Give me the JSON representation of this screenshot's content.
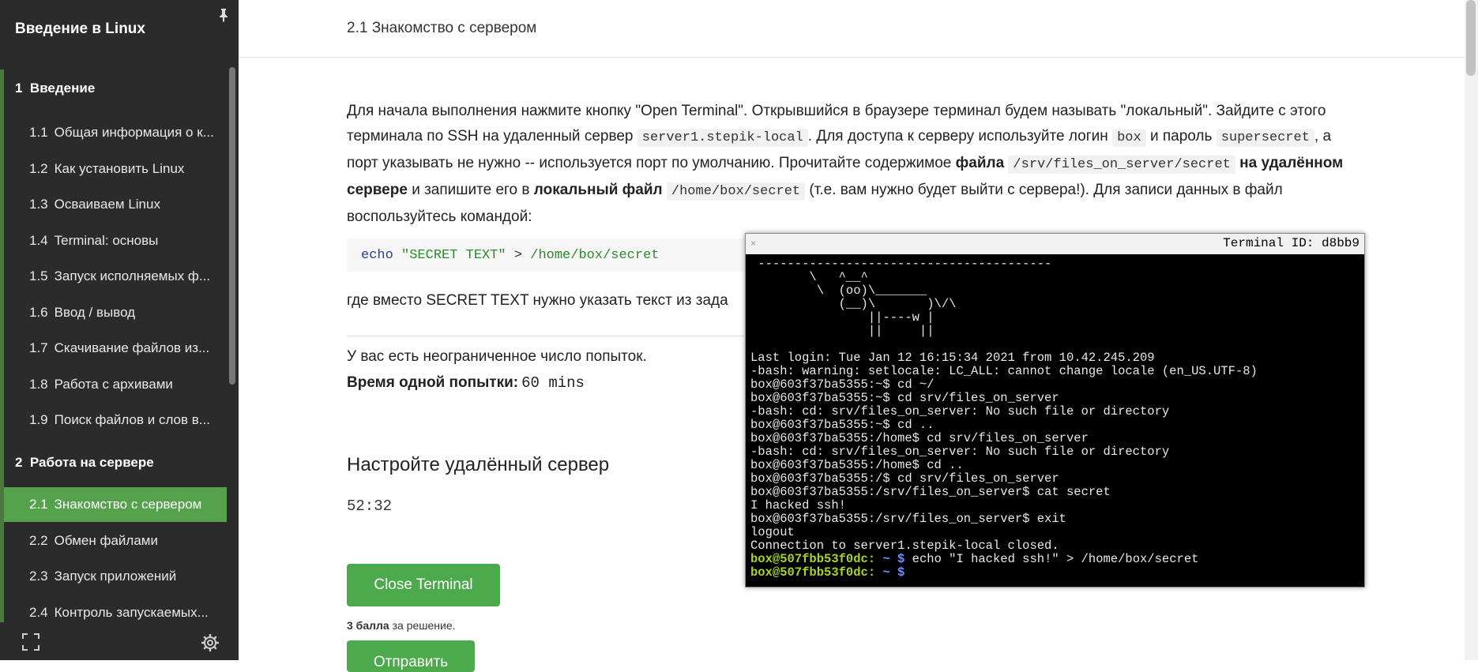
{
  "sidebar": {
    "title": "Введение в Linux",
    "modules": [
      {
        "number": "1",
        "title": "Введение"
      },
      {
        "number": "2",
        "title": "Работа на сервере"
      }
    ],
    "items": [
      {
        "number": "1.1",
        "label": "Общая информация о к..."
      },
      {
        "number": "1.2",
        "label": "Как установить Linux"
      },
      {
        "number": "1.3",
        "label": "Осваиваем Linux"
      },
      {
        "number": "1.4",
        "label": "Terminal: основы"
      },
      {
        "number": "1.5",
        "label": "Запуск исполняемых ф..."
      },
      {
        "number": "1.6",
        "label": "Ввод / вывод"
      },
      {
        "number": "1.7",
        "label": "Скачивание файлов из..."
      },
      {
        "number": "1.8",
        "label": "Работа с архивами"
      },
      {
        "number": "1.9",
        "label": "Поиск файлов и слов в..."
      },
      {
        "number": "2.1",
        "label": "Знакомство с сервером"
      },
      {
        "number": "2.2",
        "label": "Обмен файлами"
      },
      {
        "number": "2.3",
        "label": "Запуск приложений"
      },
      {
        "number": "2.4",
        "label": "Контроль запускаемых..."
      }
    ],
    "active_item": "2.1",
    "icons": {
      "pin": "pin-icon",
      "fullscreen": "fullscreen-icon",
      "settings": "gear-icon"
    }
  },
  "step": {
    "title": "2.1 Знакомство с сервером",
    "para": {
      "t1": "Для начала выполнения нажмите кнопку \"Open Terminal\". Открывшийся в браузере терминал будем называть \"локальный\". Зайдите с этого терминала по SSH на удаленный сервер ",
      "c1": "server1.stepik-local",
      "t2": ". Для доступа к серверу используйте логин ",
      "c2": "box",
      "t3": " и пароль ",
      "c3": "supersecret",
      "t4": ", а порт указывать не нужно -- используется порт по умолчанию. Прочитайте содержимое ",
      "b1": "файла",
      "c4": "/srv/files_on_server/secret",
      "b2": "на удалённом сервере",
      "t5": " и запишите его в ",
      "b3": "локальный файл",
      "c5": "/home/box/secret",
      "t6": " (т.е. вам нужно будет выйти с сервера!). Для записи данных в файл воспользуйтесь командой:"
    },
    "code": {
      "cmd": "echo",
      "str": "\"SECRET TEXT\"",
      "op": ">",
      "path": "/home/box/secret"
    },
    "after_code": "где вместо SECRET TEXT нужно указать текст из зада",
    "attempts": "У вас есть неограниченное число попыток.",
    "attempt_time_label": "Время одной попытки:",
    "attempt_time_value": "60 mins",
    "section_heading": "Настройте удалённый сервер",
    "timer": "52:32",
    "close_terminal_label": "Close Terminal",
    "score_bold": "3 балла",
    "score_rest": " за решение.",
    "submit_label": "Отправить"
  },
  "terminal": {
    "id_label": "Terminal ID: d8bb9",
    "close_symbol": "×",
    "lines": [
      " ----------------------------------------",
      "        \\   ^__^",
      "         \\  (oo)\\_______",
      "            (__)\\       )\\/\\",
      "                ||----w |",
      "                ||     ||",
      "",
      "Last login: Tue Jan 12 16:15:34 2021 from 10.42.245.209",
      "-bash: warning: setlocale: LC_ALL: cannot change locale (en_US.UTF-8)",
      "box@603f37ba5355:~$ cd ~/",
      "box@603f37ba5355:~$ cd srv/files_on_server",
      "-bash: cd: srv/files_on_server: No such file or directory",
      "box@603f37ba5355:~$ cd ..",
      "box@603f37ba5355:/home$ cd srv/files_on_server",
      "-bash: cd: srv/files_on_server: No such file or directory",
      "box@603f37ba5355:/home$ cd ..",
      "box@603f37ba5355:/$ cd srv/files_on_server",
      "box@603f37ba5355:/srv/files_on_server$ cat secret",
      "I hacked ssh!",
      "box@603f37ba5355:/srv/files_on_server$ exit",
      "logout",
      "Connection to server1.stepik-local closed."
    ],
    "prompt1": {
      "userhost": "box@507fbb53f0dc:",
      "path": " ~ ",
      "dollar": "$",
      "cmd": " echo \"I hacked ssh!\" > /home/box/secret"
    },
    "prompt2": {
      "userhost": "box@507fbb53f0dc:",
      "path": " ~ ",
      "dollar": "$",
      "cmd": ""
    }
  },
  "colors": {
    "accent_green": "#55a24d",
    "sidebar_bg": "#2b2b2b",
    "terminal_bg": "#000000",
    "prompt_green": "#a8d61f",
    "prompt_blue": "#6f8fff"
  }
}
